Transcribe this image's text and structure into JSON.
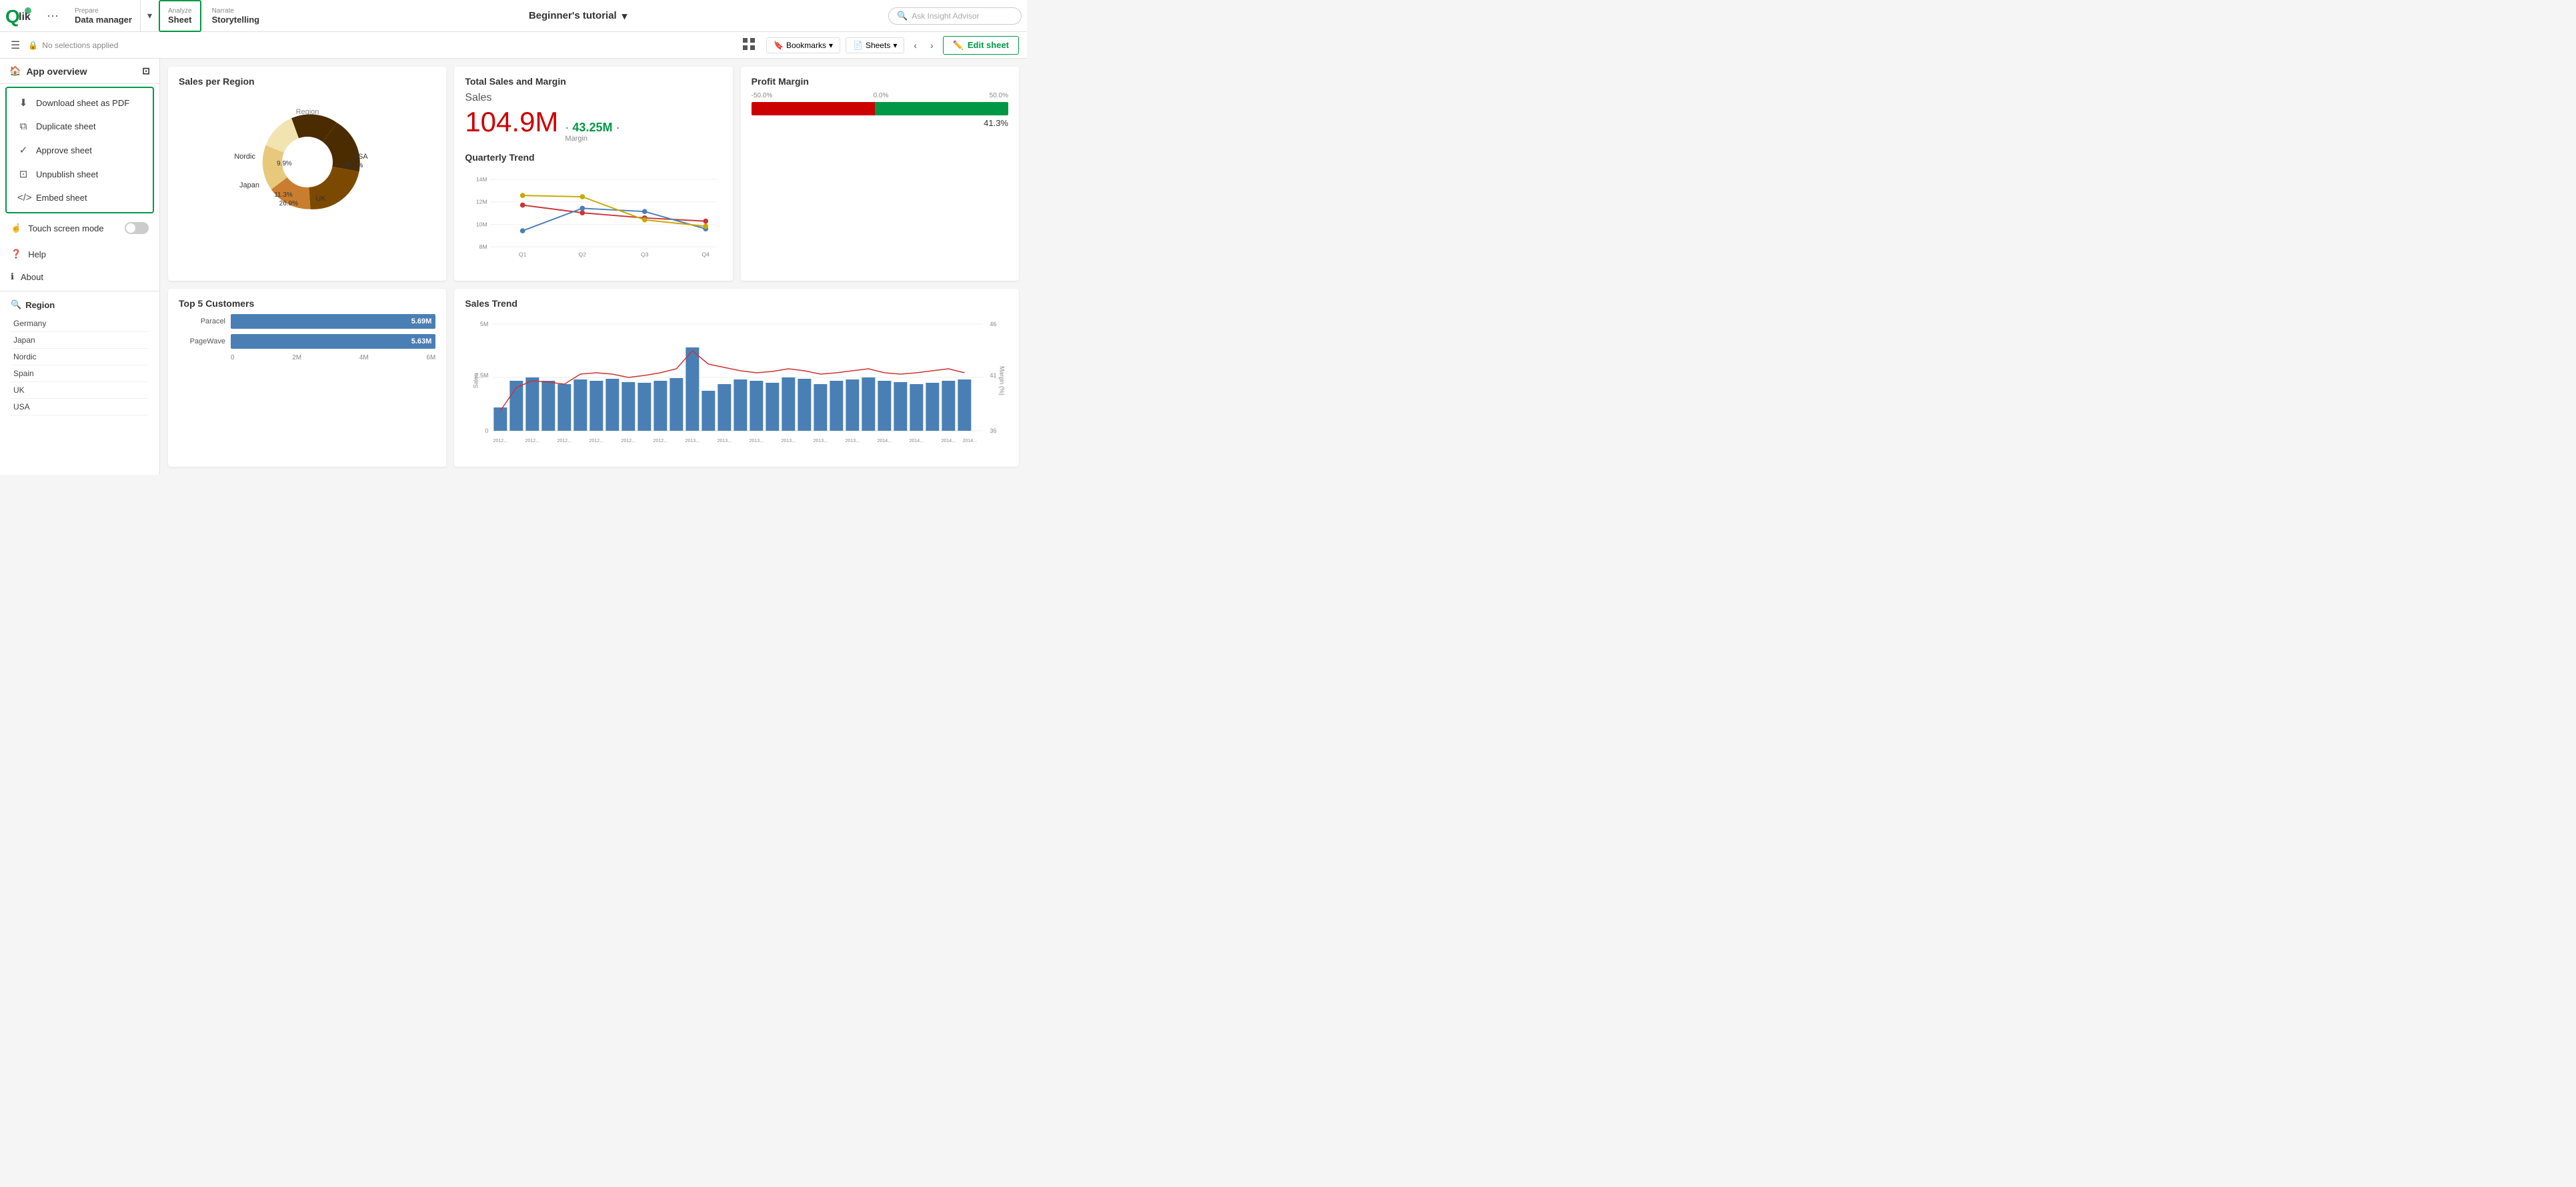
{
  "app": {
    "title": "Beginner's tutorial",
    "logo_text": "Qlik"
  },
  "nav": {
    "prepare_label": "Prepare",
    "prepare_title": "Data manager",
    "analyze_label": "Analyze",
    "analyze_title": "Sheet",
    "narrate_label": "Narrate",
    "narrate_title": "Storytelling",
    "ask_insight": "Ask Insight Advisor",
    "no_selections": "No selections applied",
    "bookmarks": "Bookmarks",
    "sheets": "Sheets",
    "edit_sheet": "Edit sheet"
  },
  "sidebar": {
    "app_overview": "App overview",
    "dropdown": {
      "items": [
        {
          "icon": "⬇",
          "label": "Download sheet as PDF"
        },
        {
          "icon": "⧉",
          "label": "Duplicate sheet"
        },
        {
          "icon": "✓",
          "label": "Approve sheet"
        },
        {
          "icon": "⊡",
          "label": "Unpublish sheet"
        },
        {
          "icon": "</>",
          "label": "Embed sheet"
        }
      ]
    },
    "touch_screen_mode": "Touch screen mode",
    "help": "Help",
    "about": "About",
    "region_title": "Region",
    "region_items": [
      "Germany",
      "Japan",
      "Nordic",
      "Spain",
      "UK",
      "USA"
    ]
  },
  "charts": {
    "sales_per_region": {
      "title": "Sales per Region",
      "segments": [
        {
          "label": "USA",
          "pct": "45.5%",
          "color": "#4a2c00"
        },
        {
          "label": "UK",
          "pct": "26.9%",
          "color": "#7b4a00"
        },
        {
          "label": "Japan",
          "pct": "11.3%",
          "color": "#c97d2e"
        },
        {
          "label": "Nordic",
          "pct": "9.9%",
          "color": "#e8c87a"
        }
      ],
      "center_label": "Region"
    },
    "total_sales": {
      "title": "Total Sales and Margin",
      "sales_label": "Sales",
      "sales_value": "104.9M",
      "margin_value": "43.25M",
      "margin_label": "Margin"
    },
    "profit_margin": {
      "title": "Profit Margin",
      "labels": [
        "-50.0%",
        "0.0%",
        "50.0%"
      ],
      "pct": "41.3%"
    },
    "top5_customers": {
      "title": "Top 5 Customers",
      "bars": [
        {
          "label": "Paracel",
          "value": "5.69M",
          "width_pct": 95
        },
        {
          "label": "PageWave",
          "value": "5.63M",
          "width_pct": 93
        }
      ],
      "axis": [
        "0",
        "2M",
        "4M",
        "6M"
      ]
    },
    "quarterly_trend": {
      "title": "Quarterly Trend",
      "y_labels": [
        "14M",
        "12M",
        "10M",
        "8M"
      ],
      "x_labels": [
        "Q1",
        "Q2",
        "Q3",
        "Q4"
      ]
    },
    "sales_trend": {
      "title": "Sales Trend",
      "y_left_labels": [
        "5M",
        "2.5M",
        "0"
      ],
      "y_right_labels": [
        "46",
        "41",
        "36"
      ],
      "x_labels": [
        "2012...",
        "2012...",
        "2012...",
        "2012...",
        "2012...",
        "2012...",
        "2012...",
        "2012...",
        "2012...",
        "2012...",
        "2012...",
        "2012...",
        "2013...",
        "2013...",
        "2013...",
        "2013...",
        "2013...",
        "2013...",
        "2013...",
        "2013...",
        "2013...",
        "2013...",
        "2013...",
        "2013...",
        "2014...",
        "2014...",
        "2014...",
        "2014...",
        "2014...",
        "2014..."
      ]
    }
  }
}
